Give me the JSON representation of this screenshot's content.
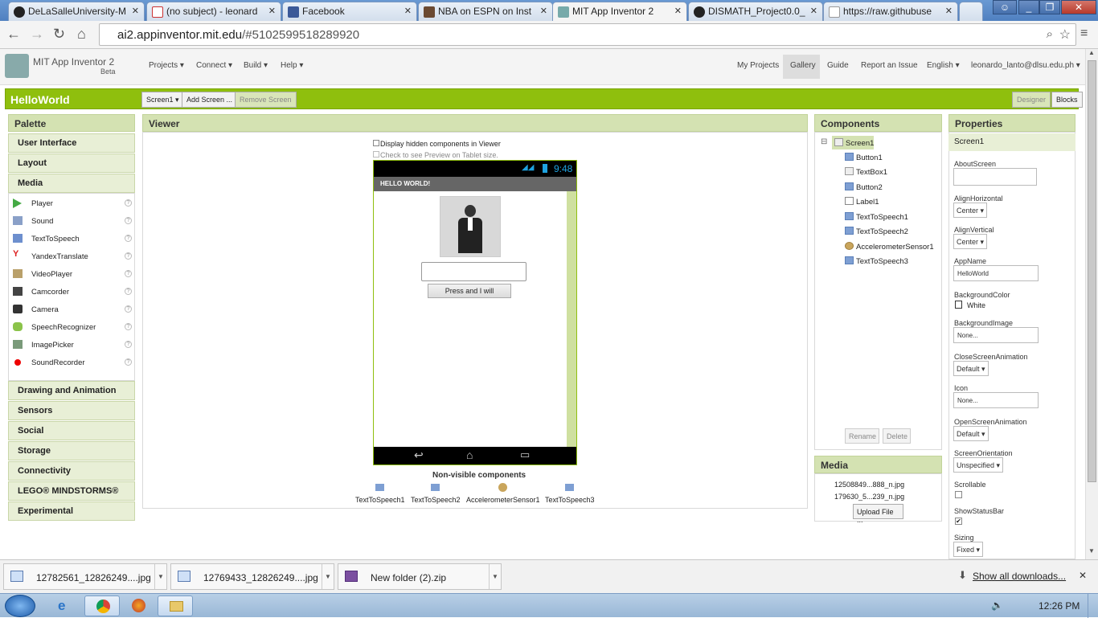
{
  "browser": {
    "tabs": [
      {
        "title": "DeLaSalleUniversity-M"
      },
      {
        "title": "(no subject) - leonard"
      },
      {
        "title": "Facebook"
      },
      {
        "title": "NBA on ESPN on Inst"
      },
      {
        "title": "MIT App Inventor 2"
      },
      {
        "title": "DISMATH_Project0.0_"
      },
      {
        "title": "https://raw.githubuse"
      }
    ],
    "url_domain": "ai2.appinventor.mit.edu",
    "url_path": "/#5102599518289920"
  },
  "app": {
    "title": "MIT App Inventor 2",
    "subtitle": "Beta",
    "menus": [
      "Projects ▾",
      "Connect ▾",
      "Build ▾",
      "Help ▾"
    ],
    "top_links": [
      "My Projects",
      "Gallery",
      "Guide",
      "Report an Issue",
      "English ▾",
      "leonardo_lanto@dlsu.edu.ph ▾"
    ]
  },
  "project": {
    "name": "HelloWorld",
    "screen_select": "Screen1 ▾",
    "add_screen": "Add Screen ...",
    "remove_screen": "Remove Screen",
    "designer": "Designer",
    "blocks": "Blocks"
  },
  "palette": {
    "title": "Palette",
    "categories_top": [
      "User Interface",
      "Layout",
      "Media"
    ],
    "items": [
      "Player",
      "Sound",
      "TextToSpeech",
      "YandexTranslate",
      "VideoPlayer",
      "Camcorder",
      "Camera",
      "SpeechRecognizer",
      "ImagePicker",
      "SoundRecorder"
    ],
    "help": "?",
    "categories_bottom": [
      "Drawing and Animation",
      "Sensors",
      "Social",
      "Storage",
      "Connectivity",
      "LEGO® MINDSTORMS®",
      "Experimental"
    ]
  },
  "viewer": {
    "title": "Viewer",
    "check_hidden": "Display hidden components in Viewer",
    "check_tablet": "Check to see Preview on Tablet size.",
    "time": "9:48",
    "screen_title": "HELLO WORLD!",
    "button_text": "Press and I will",
    "nonvisible_title": "Non-visible components",
    "nonvisible": [
      "TextToSpeech1",
      "TextToSpeech2",
      "AccelerometerSensor1",
      "TextToSpeech3"
    ]
  },
  "components": {
    "title": "Components",
    "root": "Screen1",
    "collapse": "⊟",
    "items": [
      "Button1",
      "TextBox1",
      "Button2",
      "Label1",
      "TextToSpeech1",
      "TextToSpeech2",
      "AccelerometerSensor1",
      "TextToSpeech3"
    ],
    "rename": "Rename",
    "delete": "Delete"
  },
  "media": {
    "title": "Media",
    "files": [
      "12508849...888_n.jpg",
      "179630_5...239_n.jpg"
    ],
    "upload": "Upload File ..."
  },
  "properties": {
    "title": "Properties",
    "selected": "Screen1",
    "about_screen_label": "AboutScreen",
    "align_h_label": "AlignHorizontal",
    "align_h_value": "Center ▾",
    "align_v_label": "AlignVertical",
    "align_v_value": "Center ▾",
    "app_name_label": "AppName",
    "app_name_value": "HelloWorld",
    "bg_color_label": "BackgroundColor",
    "bg_color_value": "White",
    "bg_image_label": "BackgroundImage",
    "bg_image_value": "None...",
    "close_anim_label": "CloseScreenAnimation",
    "close_anim_value": "Default ▾",
    "icon_label": "Icon",
    "icon_value": "None...",
    "open_anim_label": "OpenScreenAnimation",
    "open_anim_value": "Default ▾",
    "orientation_label": "ScreenOrientation",
    "orientation_value": "Unspecified ▾",
    "scrollable_label": "Scrollable",
    "status_bar_label": "ShowStatusBar",
    "checkmark": "✔",
    "sizing_label": "Sizing",
    "sizing_value": "Fixed ▾"
  },
  "downloads": {
    "files": [
      "12782561_12826249....jpg",
      "12769433_12826249....jpg",
      "New folder (2).zip"
    ],
    "show_all": "Show all downloads...",
    "close": "✕"
  },
  "taskbar": {
    "time": "12:26 PM"
  },
  "colors": {
    "green_bar": "#8fbf0d",
    "panel_header": "#d4e2b2"
  }
}
